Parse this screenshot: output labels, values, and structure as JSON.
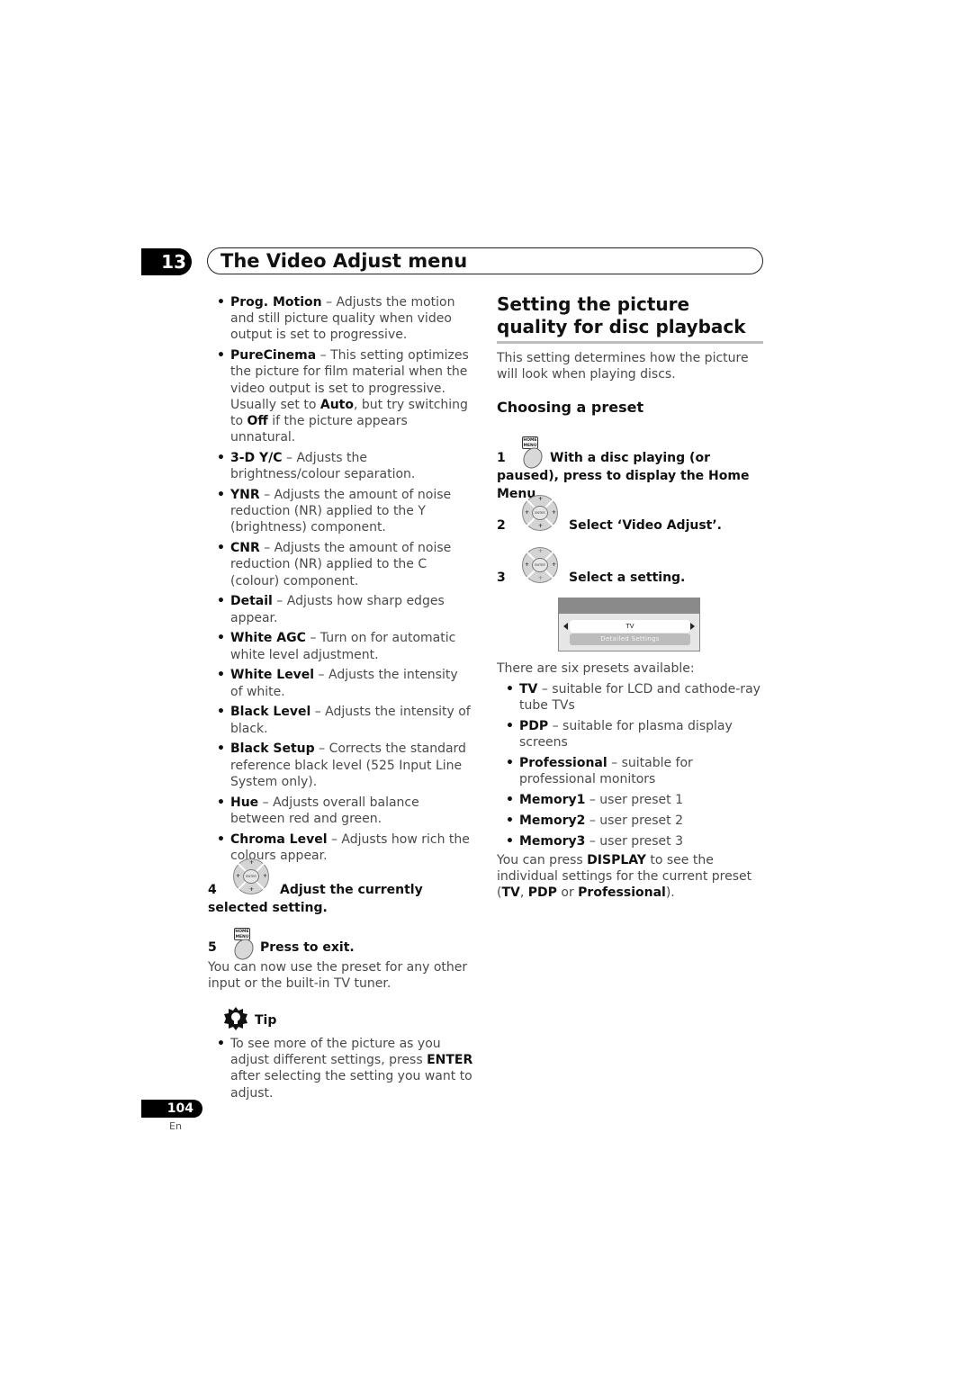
{
  "chapter": {
    "number": "13",
    "title": "The Video Adjust menu"
  },
  "left_column": {
    "settings": [
      {
        "name": "Prog. Motion",
        "desc": " – Adjusts the motion and still picture quality when video output is set to progressive."
      },
      {
        "name": "PureCinema",
        "desc_parts": [
          " – This setting optimizes the picture for film material when the video output is set to progressive. Usually set to ",
          "Auto",
          ", but try switching to ",
          "Off",
          " if the picture appears unnatural."
        ]
      },
      {
        "name": "3-D Y/C",
        "desc": " – Adjusts the brightness/colour separation."
      },
      {
        "name": "YNR",
        "desc": " – Adjusts the amount of noise reduction (NR) applied to the Y (brightness) component."
      },
      {
        "name": "CNR",
        "desc": " – Adjusts the amount of noise reduction (NR) applied to the C (colour) component."
      },
      {
        "name": "Detail",
        "desc": " – Adjusts how sharp edges appear."
      },
      {
        "name": "White AGC",
        "desc": " – Turn on for automatic white level adjustment."
      },
      {
        "name": "White Level",
        "desc": " – Adjusts the intensity of white."
      },
      {
        "name": "Black Level",
        "desc": " – Adjusts the intensity of black."
      },
      {
        "name": "Black Setup",
        "desc": " – Corrects the standard reference black level (525 Input Line System only)."
      },
      {
        "name": "Hue",
        "desc": " – Adjusts overall balance between red and green."
      },
      {
        "name": "Chroma Level",
        "desc": " – Adjusts how rich the colours appear."
      }
    ],
    "step4": {
      "num": "4",
      "text": "Adjust the currently selected setting."
    },
    "step5": {
      "num": "5",
      "text": "Press to exit."
    },
    "after_text": "You can now use the preset for any other input or the built-in TV tuner.",
    "tip": {
      "label": "Tip",
      "parts": [
        "To see more of the picture as you adjust different settings, press ",
        "ENTER",
        " after selecting the setting you want to adjust."
      ]
    }
  },
  "right_column": {
    "section_title": "Setting the picture quality for disc playback",
    "intro": "This setting determines how the picture will look when playing discs.",
    "subsection_title": "Choosing a preset",
    "step1": {
      "num": "1",
      "text": "With a disc playing (or paused), press to display the Home Menu."
    },
    "step2": {
      "num": "2",
      "text": "Select ‘Video Adjust’."
    },
    "step3": {
      "num": "3",
      "text": "Select a setting."
    },
    "osd": {
      "selected": "TV",
      "detail_button": "Detailed Settings"
    },
    "presets_intro": "There are six presets available:",
    "presets": [
      {
        "name": "TV",
        "desc": " – suitable for LCD and cathode-ray tube TVs"
      },
      {
        "name": "PDP",
        "desc": " – suitable for plasma display screens"
      },
      {
        "name": "Professional",
        "desc": " – suitable for professional monitors"
      },
      {
        "name": "Memory1",
        "desc": " – user preset 1"
      },
      {
        "name": "Memory2",
        "desc": " – user preset 2"
      },
      {
        "name": "Memory3",
        "desc": " – user preset 3"
      }
    ],
    "display_note": {
      "parts": [
        "You can press ",
        "DISPLAY",
        " to see the individual settings for the current preset (",
        "TV",
        ", ",
        "PDP",
        " or ",
        "Professional",
        ")."
      ]
    }
  },
  "icons": {
    "home_menu_label": "HOME MENU",
    "enter_label": "ENTER"
  },
  "footer": {
    "page_number": "104",
    "language": "En"
  }
}
